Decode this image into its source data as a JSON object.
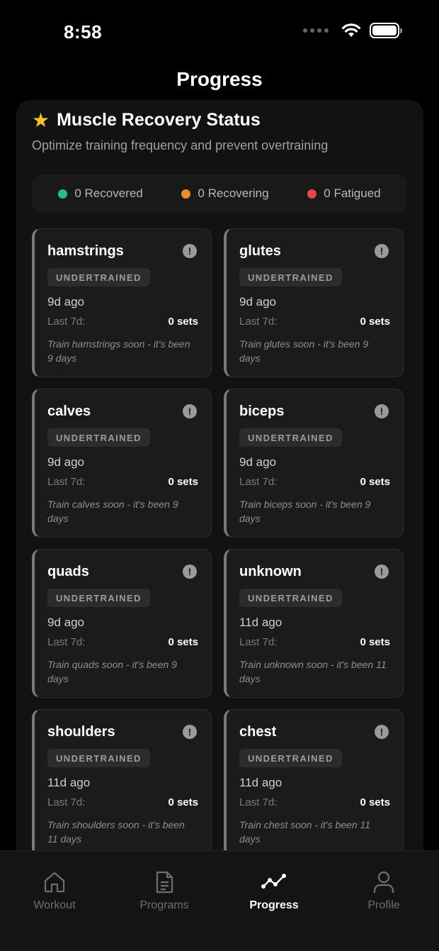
{
  "status_bar": {
    "time": "8:58"
  },
  "header": {
    "title": "Progress"
  },
  "section": {
    "icon": "star-icon",
    "title": "Muscle Recovery Status",
    "subtitle": "Optimize training frequency and prevent overtraining"
  },
  "summary": [
    {
      "label": "0 Recovered",
      "color": "#22c07a"
    },
    {
      "label": "0 Recovering",
      "color": "#f08a24"
    },
    {
      "label": "0 Fatigued",
      "color": "#e8454f"
    }
  ],
  "cards": [
    {
      "name": "hamstrings",
      "status": "UNDERTRAINED",
      "ago": "9d ago",
      "last_label": "Last 7d:",
      "sets": "0 sets",
      "note": "Train hamstrings soon - it's been 9 days"
    },
    {
      "name": "glutes",
      "status": "UNDERTRAINED",
      "ago": "9d ago",
      "last_label": "Last 7d:",
      "sets": "0 sets",
      "note": "Train glutes soon - it's been 9 days"
    },
    {
      "name": "calves",
      "status": "UNDERTRAINED",
      "ago": "9d ago",
      "last_label": "Last 7d:",
      "sets": "0 sets",
      "note": "Train calves soon - it's been 9 days"
    },
    {
      "name": "biceps",
      "status": "UNDERTRAINED",
      "ago": "9d ago",
      "last_label": "Last 7d:",
      "sets": "0 sets",
      "note": "Train biceps soon - it's been 9 days"
    },
    {
      "name": "quads",
      "status": "UNDERTRAINED",
      "ago": "9d ago",
      "last_label": "Last 7d:",
      "sets": "0 sets",
      "note": "Train quads soon - it's been 9 days"
    },
    {
      "name": "unknown",
      "status": "UNDERTRAINED",
      "ago": "11d ago",
      "last_label": "Last 7d:",
      "sets": "0 sets",
      "note": "Train unknown soon - it's been 11 days"
    },
    {
      "name": "shoulders",
      "status": "UNDERTRAINED",
      "ago": "11d ago",
      "last_label": "Last 7d:",
      "sets": "0 sets",
      "note": "Train shoulders soon - it's been 11 days"
    },
    {
      "name": "chest",
      "status": "UNDERTRAINED",
      "ago": "11d ago",
      "last_label": "Last 7d:",
      "sets": "0 sets",
      "note": "Train chest soon - it's been 11 days"
    }
  ],
  "tabs": [
    {
      "label": "Workout",
      "icon": "home-icon",
      "active": false
    },
    {
      "label": "Programs",
      "icon": "document-icon",
      "active": false
    },
    {
      "label": "Progress",
      "icon": "trend-icon",
      "active": true
    },
    {
      "label": "Profile",
      "icon": "user-icon",
      "active": false
    }
  ]
}
